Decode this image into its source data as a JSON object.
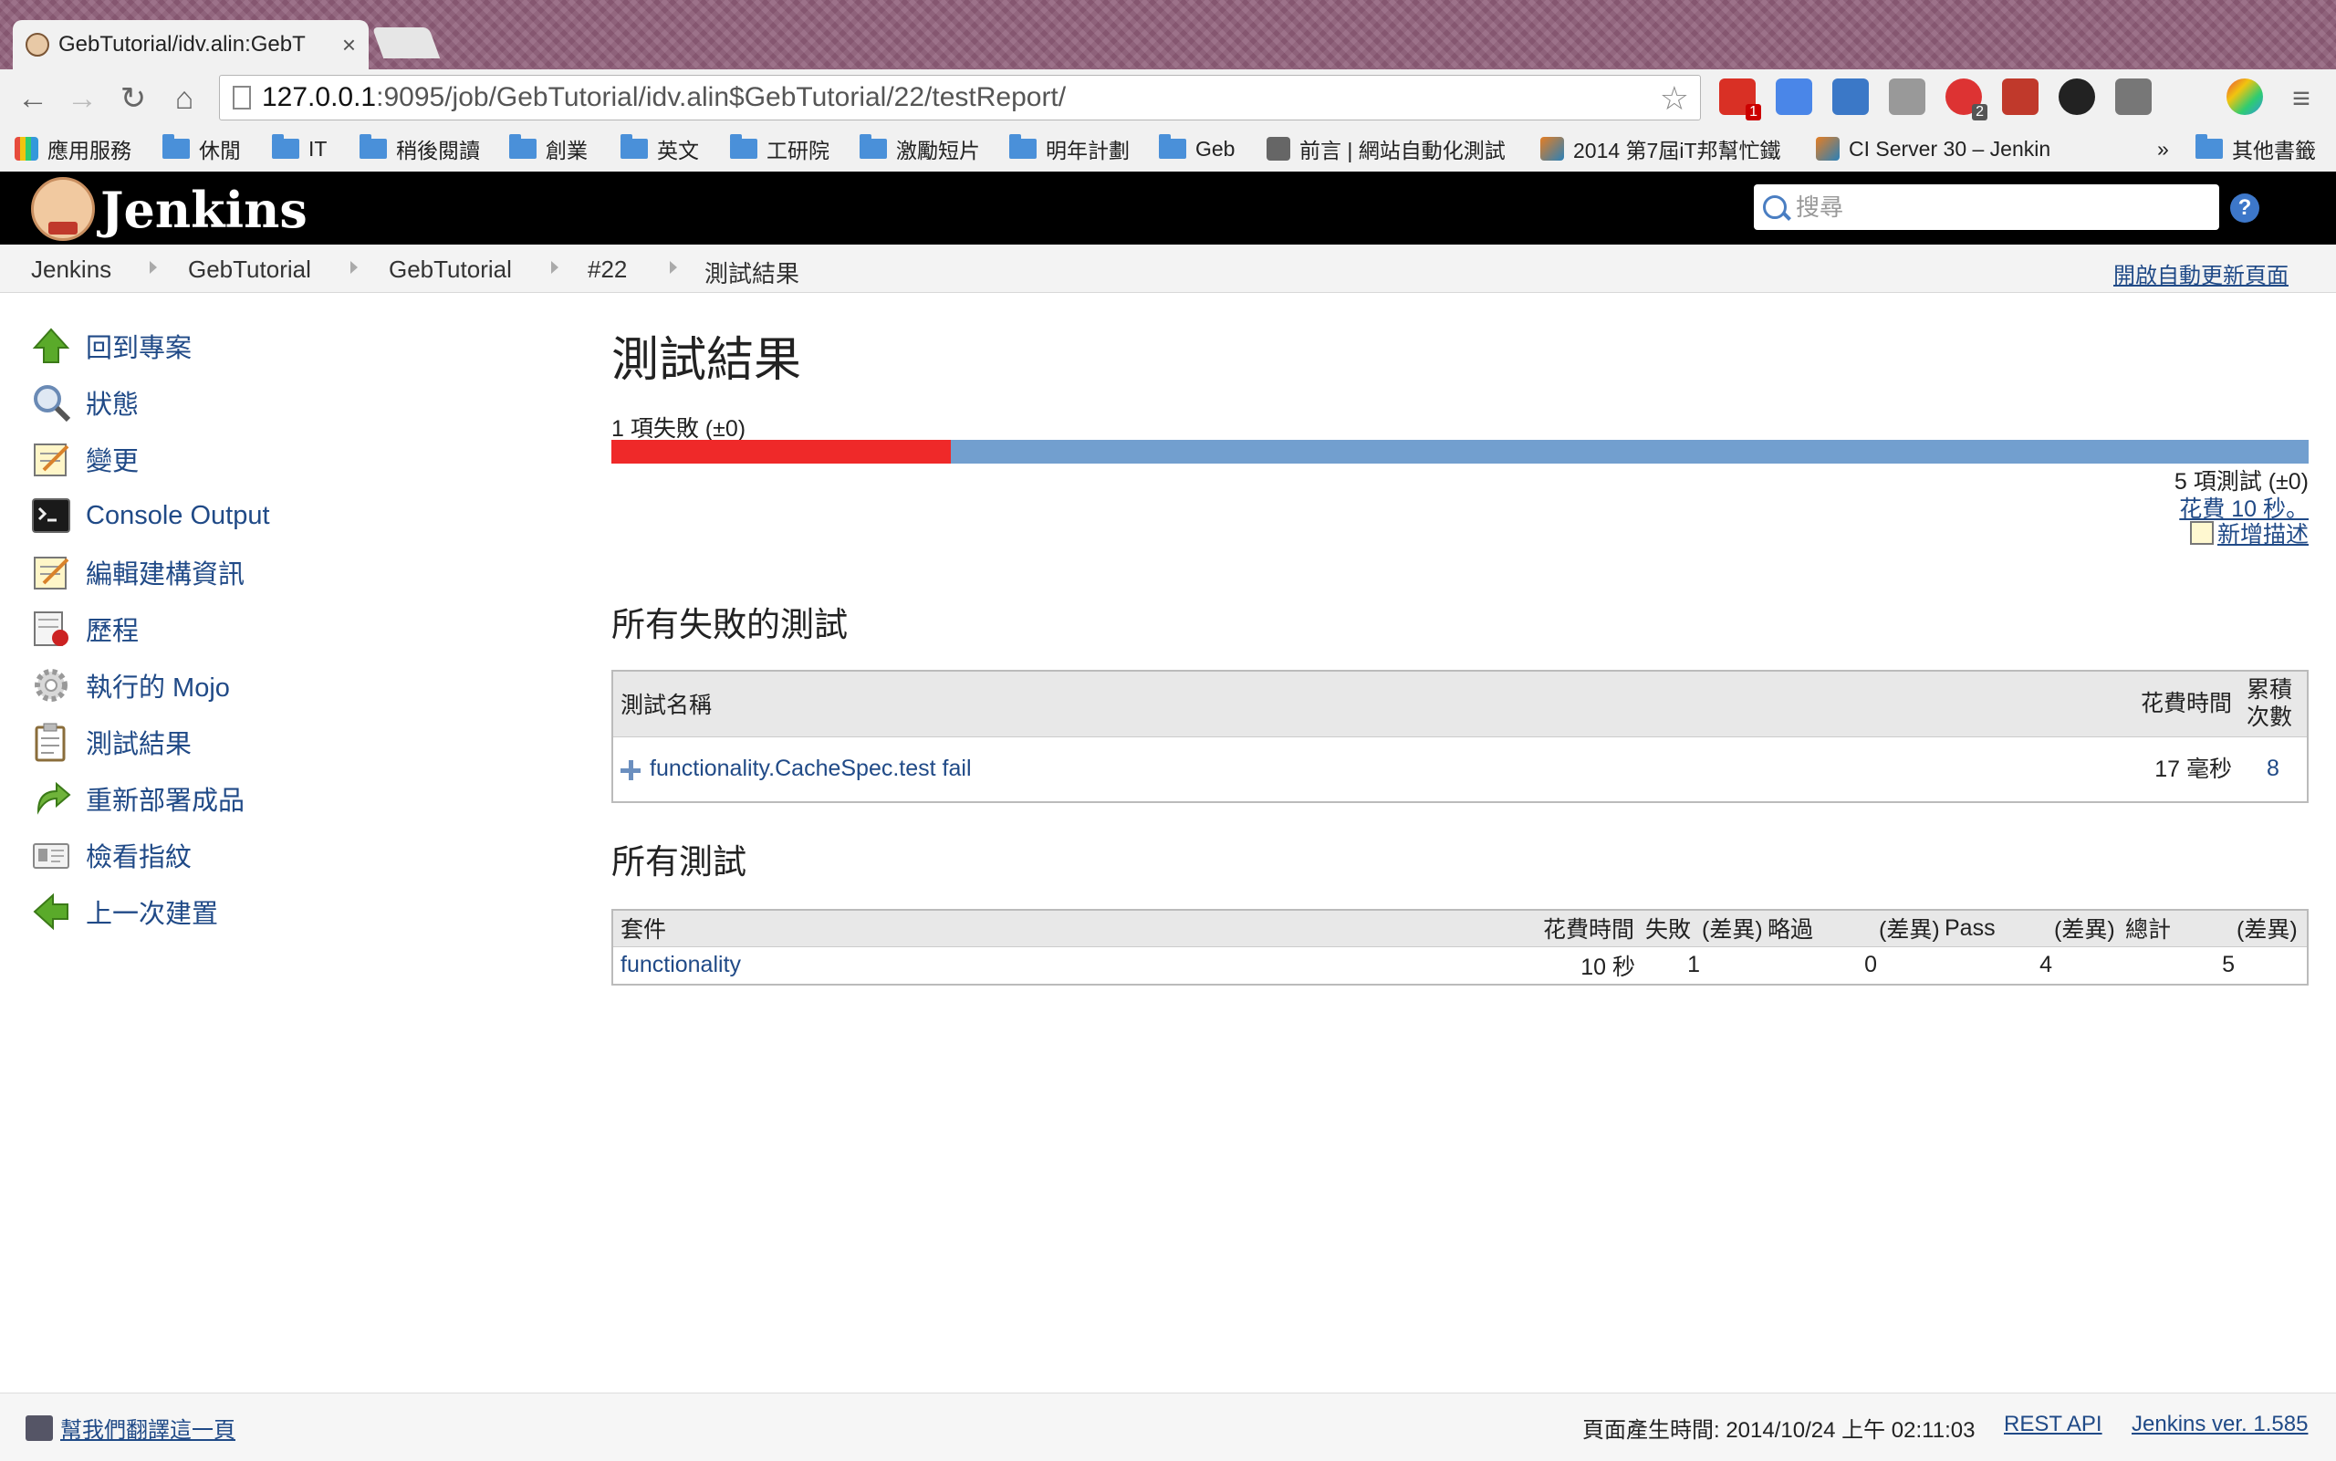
{
  "browser": {
    "tab_title": "GebTutorial/idv.alin:GebT",
    "tab_close": "×",
    "url_host": "127.0.0.1",
    "url_rest": ":9095/job/GebTutorial/idv.alin$GebTutorial/22/testReport/",
    "nav": {
      "back": "←",
      "forward": "→",
      "reload": "↻",
      "home": "⌂"
    },
    "star": "☆",
    "menu": "≡",
    "extension_badges": [
      "1",
      "2"
    ]
  },
  "bookmarks": {
    "items": [
      "應用服務",
      "休閒",
      "IT",
      "稍後閱讀",
      "創業",
      "英文",
      "工研院",
      "激勵短片",
      "明年計劃",
      "Geb",
      "前言 | 網站自動化測試",
      "2014 第7屆iT邦幫忙鐵",
      "CI Server 30 – Jenkin"
    ],
    "overflow": "»",
    "other": "其他書籤"
  },
  "header": {
    "logo_text": "Jenkins",
    "search_placeholder": "搜尋",
    "help": "?"
  },
  "breadcrumb": {
    "items": [
      "Jenkins",
      "GebTutorial",
      "GebTutorial",
      "#22",
      "測試結果"
    ],
    "auto_refresh": "開啟自動更新頁面"
  },
  "sidebar": {
    "items": [
      {
        "label": "回到專案",
        "icon": "up-arrow-icon"
      },
      {
        "label": "狀態",
        "icon": "magnifier-icon"
      },
      {
        "label": "變更",
        "icon": "notepad-icon"
      },
      {
        "label": "Console Output",
        "icon": "terminal-icon"
      },
      {
        "label": "編輯建構資訊",
        "icon": "notepad-icon"
      },
      {
        "label": "歷程",
        "icon": "history-icon"
      },
      {
        "label": "執行的 Mojo",
        "icon": "gear-icon"
      },
      {
        "label": "測試結果",
        "icon": "clipboard-icon"
      },
      {
        "label": "重新部署成品",
        "icon": "redeploy-icon"
      },
      {
        "label": "檢看指紋",
        "icon": "fingerprint-icon"
      },
      {
        "label": "上一次建置",
        "icon": "left-arrow-icon"
      }
    ]
  },
  "main": {
    "title": "測試結果",
    "fail_summary": "1 項失敗 (±0)",
    "fail_fraction": 0.2,
    "total_tests": "5 項測試 (±0)",
    "duration_link": "花費 10 秒。",
    "add_description": "新增描述",
    "failed_section_title": "所有失敗的測試",
    "failed_table": {
      "headers": {
        "name": "測試名稱",
        "duration": "花費時間",
        "age": "累積次數"
      },
      "rows": [
        {
          "name": "functionality.CacheSpec.test fail",
          "duration": "17 毫秒",
          "age": "8"
        }
      ]
    },
    "all_section_title": "所有測試",
    "all_table": {
      "headers": [
        "套件",
        "花費時間",
        "失敗",
        "(差異)",
        "略過",
        "(差異)",
        "Pass",
        "(差異)",
        "總計",
        "(差異)"
      ],
      "rows": [
        {
          "suite": "functionality",
          "duration": "10 秒",
          "fail": "1",
          "fail_diff": "",
          "skip": "0",
          "skip_diff": "",
          "pass": "4",
          "pass_diff": "",
          "total": "5",
          "total_diff": ""
        }
      ]
    }
  },
  "footer": {
    "translate": "幫我們翻譯這一頁",
    "generated": "頁面產生時間: 2014/10/24 上午 02:11:03",
    "rest_api": "REST API",
    "version": "Jenkins ver. 1.585"
  },
  "colors": {
    "fail": "#ef2929",
    "pass": "#729fcf",
    "link": "#204a87",
    "header": "#000000"
  }
}
